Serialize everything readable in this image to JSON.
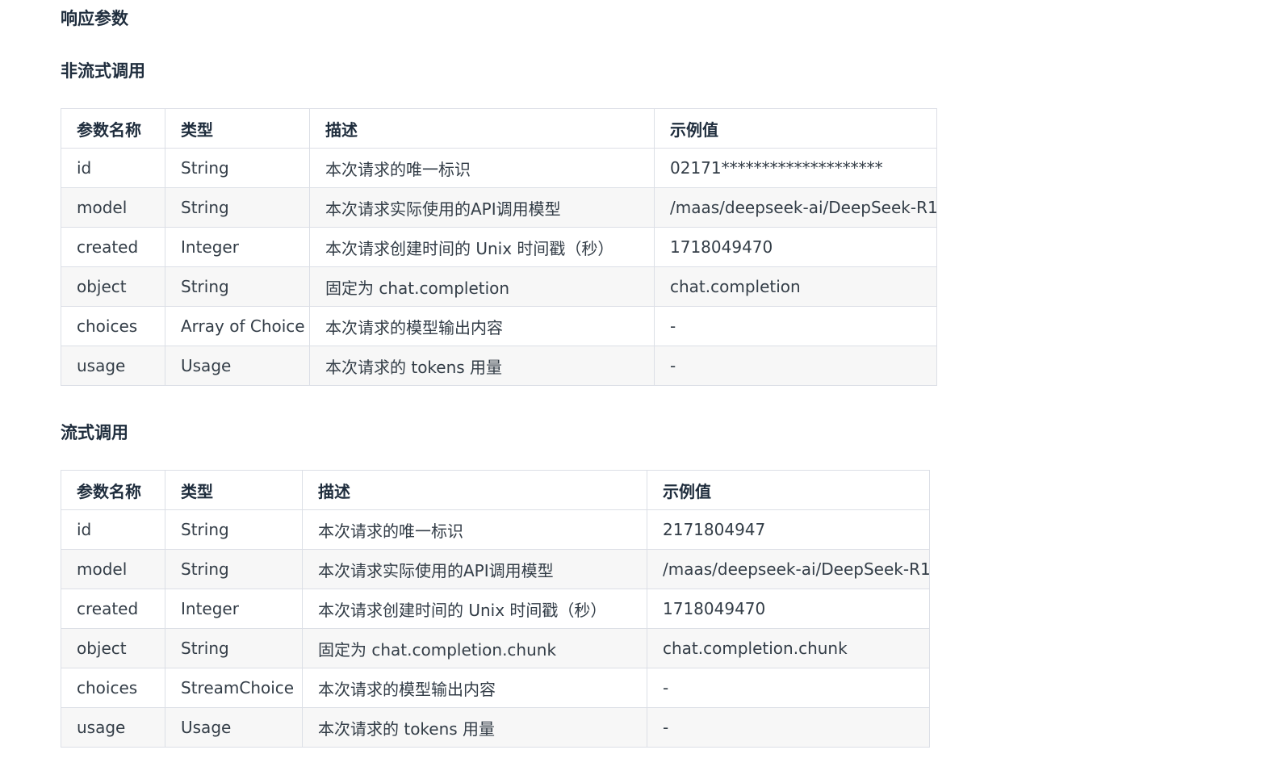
{
  "headings": {
    "main": "响应参数",
    "nonstream": "非流式调用",
    "stream": "流式调用"
  },
  "columns": [
    "参数名称",
    "类型",
    "描述",
    "示例值"
  ],
  "nonstream_table": {
    "rows": [
      [
        "id",
        "String",
        "本次请求的唯一标识",
        "02171********************"
      ],
      [
        "model",
        "String",
        "本次请求实际使用的API调用模型",
        "/maas/deepseek-ai/DeepSeek-R1"
      ],
      [
        "created",
        "Integer",
        "本次请求创建时间的 Unix 时间戳（秒）",
        "1718049470"
      ],
      [
        "object",
        "String",
        "固定为 chat.completion",
        "chat.completion"
      ],
      [
        "choices",
        "Array of Choice",
        "本次请求的模型输出内容",
        "-"
      ],
      [
        "usage",
        "Usage",
        "本次请求的 tokens 用量",
        "-"
      ]
    ]
  },
  "stream_table": {
    "rows": [
      [
        "id",
        "String",
        "本次请求的唯一标识",
        "2171804947"
      ],
      [
        "model",
        "String",
        "本次请求实际使用的API调用模型",
        "/maas/deepseek-ai/DeepSeek-R1"
      ],
      [
        "created",
        "Integer",
        "本次请求创建时间的 Unix 时间戳（秒）",
        "1718049470"
      ],
      [
        "object",
        "String",
        "固定为 chat.completion.chunk",
        "chat.completion.chunk"
      ],
      [
        "choices",
        "StreamChoice",
        "本次请求的模型输出内容",
        "-"
      ],
      [
        "usage",
        "Usage",
        "本次请求的 tokens 用量",
        "-"
      ]
    ]
  }
}
